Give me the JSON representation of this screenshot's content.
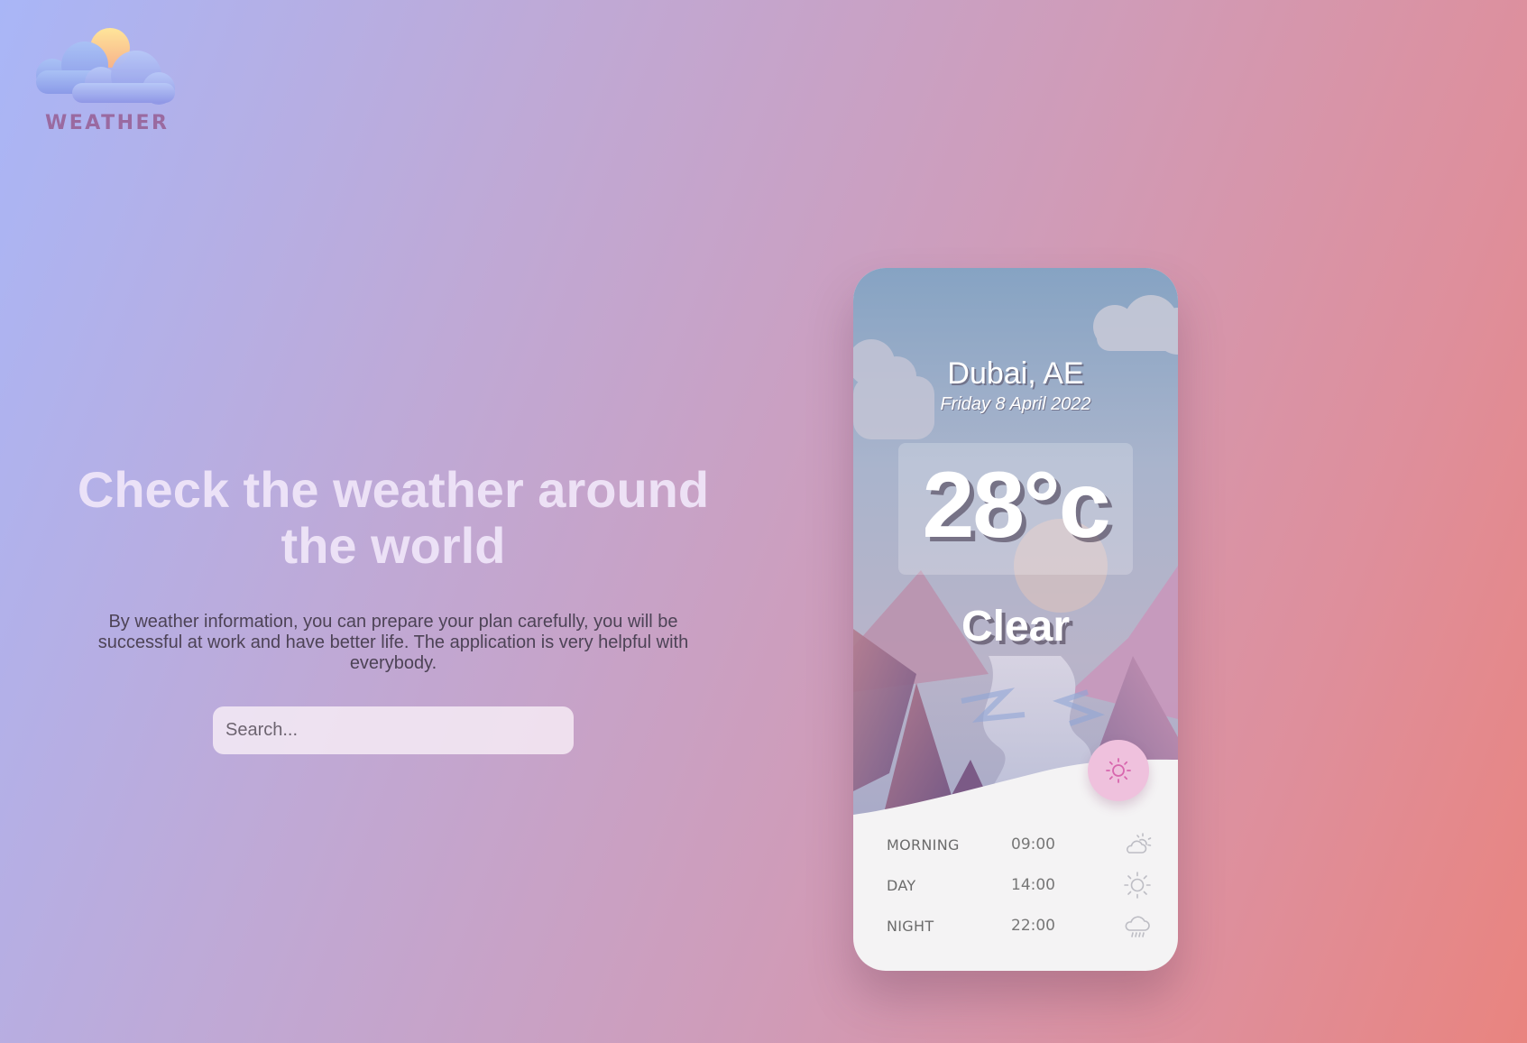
{
  "brand": {
    "logo_text": "WEATHER",
    "logo_icon": "cloud-sun-icon"
  },
  "hero": {
    "title": "Check the weather around the world",
    "description": "By weather information, you can prepare your plan carefully, you will be successful at work and have better life. The application is very helpful with everybody.",
    "search_placeholder": "Search..."
  },
  "weather_card": {
    "location": "Dubai, AE",
    "date": "Friday 8 April 2022",
    "temperature": "28°c",
    "condition": "Clear",
    "condition_icon": "sun-icon",
    "forecast": [
      {
        "period": "MORNING",
        "time": "09:00",
        "icon": "cloud-sun-icon"
      },
      {
        "period": "DAY",
        "time": "14:00",
        "icon": "sun-icon"
      },
      {
        "period": "NIGHT",
        "time": "22:00",
        "icon": "cloud-rain-icon"
      }
    ]
  },
  "colors": {
    "accent_pink": "#efc1dd",
    "sun_icon": "#d867ae",
    "text_dark": "#4d4356"
  }
}
